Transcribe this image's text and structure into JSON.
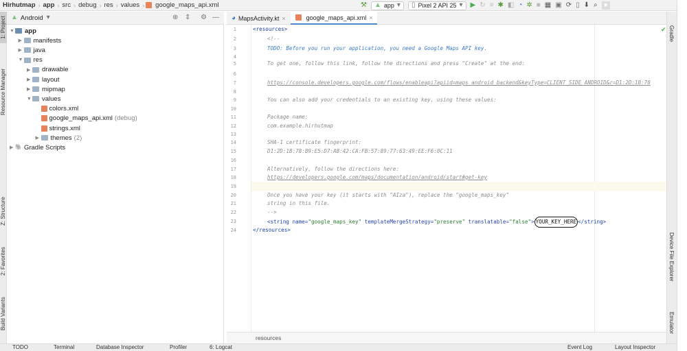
{
  "breadcrumb": [
    "Hirhutmap",
    "app",
    "src",
    "debug",
    "res",
    "values",
    "google_maps_api.xml"
  ],
  "toolbar": {
    "run_config": "app",
    "device": "Pixel 2 API 25"
  },
  "project_panel": {
    "view": "Android"
  },
  "tree": [
    {
      "label": "app",
      "level": 0,
      "type": "module",
      "expanded": true
    },
    {
      "label": "manifests",
      "level": 1,
      "type": "folder"
    },
    {
      "label": "java",
      "level": 1,
      "type": "folder"
    },
    {
      "label": "res",
      "level": 1,
      "type": "folder",
      "expanded": true
    },
    {
      "label": "drawable",
      "level": 2,
      "type": "folder"
    },
    {
      "label": "layout",
      "level": 2,
      "type": "folder"
    },
    {
      "label": "mipmap",
      "level": 2,
      "type": "folder"
    },
    {
      "label": "values",
      "level": 2,
      "type": "folder",
      "expanded": true
    },
    {
      "label": "colors.xml",
      "level": 3,
      "type": "file"
    },
    {
      "label": "google_maps_api.xml",
      "level": 3,
      "type": "file",
      "hint": "(debug)"
    },
    {
      "label": "strings.xml",
      "level": 3,
      "type": "file"
    },
    {
      "label": "themes",
      "level": 3,
      "type": "folder",
      "hint": "(2)"
    },
    {
      "label": "Gradle Scripts",
      "level": 0,
      "type": "gradle"
    }
  ],
  "tabs": [
    {
      "label": "MapsActivity.kt",
      "active": false
    },
    {
      "label": "google_maps_api.xml",
      "active": true
    }
  ],
  "code": {
    "l1": "<resources>",
    "l2": "<!--",
    "l3": "TODO: Before you run your application, you need a Google Maps API key.",
    "l5": "To get one, follow this link, follow the directions and press \"Create\" at the end:",
    "l7": "https://console.developers.google.com/flows/enableapi?apiid=maps_android_backend&keyType=CLIENT_SIDE_ANDROID&r=D1:2D:1B:78",
    "l9": "You can also add your credentials to an existing key, using these values:",
    "l11": "Package name:",
    "l12": "com.example.hirhutmap",
    "l14": "SHA-1 certificate fingerprint:",
    "l15": "D1:2D:1B:78:B9:E5:D7:AB:42:CA:FB:57:89:77:63:49:EE:F6:0C:11",
    "l17": "Alternatively, follow the directions here:",
    "l18": "https://developers.google.com/maps/documentation/android/start#get-key",
    "l20": "Once you have your key (it starts with \"AIza\"), replace the \"google_maps_key\"",
    "l21": "string in this file.",
    "l22": "-->",
    "l23_open": "<string",
    "l23_attr1": " name=",
    "l23_val1": "\"google_maps_key\"",
    "l23_attr2": " templateMergeStrategy=",
    "l23_val2": "\"preserve\"",
    "l23_attr3": " translatable=",
    "l23_val3": "\"false\"",
    "l23_gt": ">",
    "l23_text": "YOUR_KEY_HERE",
    "l23_close": "</string>",
    "l24": "</resources>"
  },
  "editor_breadcrumb": "resources",
  "left_tool_tabs": [
    "1: Project",
    "Resource Manager",
    "Z: Structure",
    "2: Favorites",
    "Build Variants"
  ],
  "right_tool_tabs": [
    "Gradle",
    "Device File Explorer",
    "Emulator"
  ],
  "bottom_tools": [
    "TODO",
    "Terminal",
    "Database Inspector",
    "Profiler",
    "6: Logcat",
    "Event Log",
    "Layout Inspector"
  ]
}
